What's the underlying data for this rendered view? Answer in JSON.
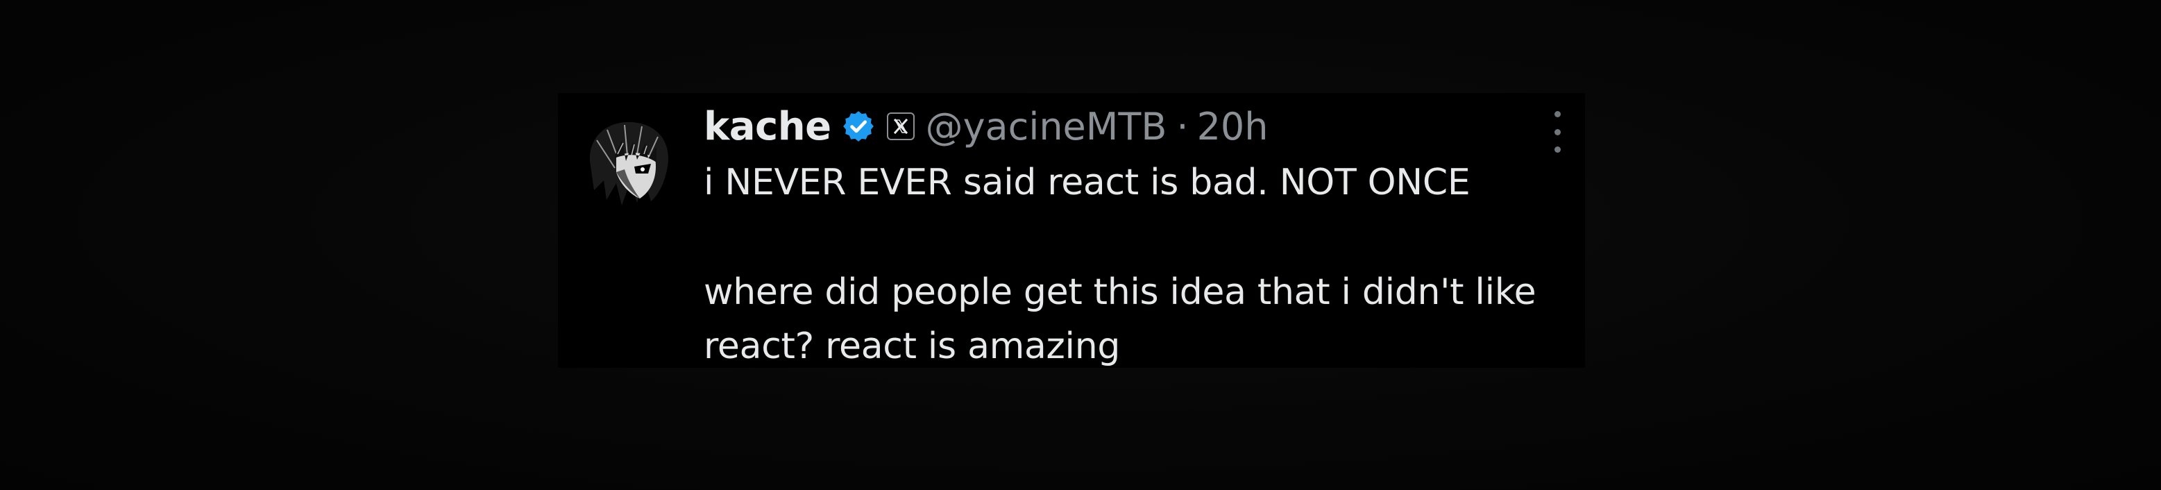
{
  "tweet": {
    "author": {
      "display_name": "kache",
      "handle": "@yacineMTB",
      "verified": true,
      "verified_color": "#1d9bf0",
      "avatar_icon": "anime-avatar-icon",
      "affiliate_badge_icon": "x-logo-icon"
    },
    "separator": "·",
    "timestamp": "20h",
    "text_line_1": "i NEVER EVER said react is bad. NOT ONCE",
    "text_line_2": "where did people get this idea that i didn't like react? react is amazing",
    "more_icon": "more-options-icon"
  },
  "colors": {
    "background": "#000000",
    "primary_text": "#e7e9ea",
    "secondary_text": "#8b9096",
    "accent": "#1d9bf0"
  }
}
